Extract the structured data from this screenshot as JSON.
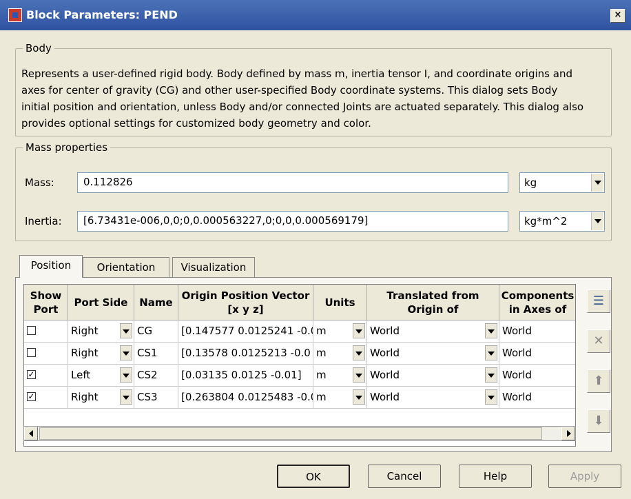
{
  "window": {
    "title": "Block Parameters: PEND",
    "close_label": "×"
  },
  "body_group": {
    "legend": "Body",
    "description": "Represents a user-defined rigid body. Body defined by mass m, inertia tensor I, and coordinate origins and axes for center of gravity (CG) and other user-specified Body coordinate systems. This dialog sets Body initial position and orientation, unless Body and/or connected Joints are actuated separately. This dialog also provides optional settings for customized body geometry and color."
  },
  "mass_properties": {
    "legend": "Mass properties",
    "mass_label": "Mass:",
    "mass_value": "0.112826",
    "mass_unit": "kg",
    "inertia_label": "Inertia:",
    "inertia_value": "[6.73431e-006,0,0;0,0.000563227,0;0,0,0.000569179]",
    "inertia_unit": "kg*m^2"
  },
  "tabs": [
    {
      "label": "Position",
      "active": true
    },
    {
      "label": "Orientation",
      "active": false
    },
    {
      "label": "Visualization",
      "active": false
    }
  ],
  "table": {
    "headers": [
      "Show Port",
      "Port Side",
      "Name",
      "Origin Position Vector [x y z]",
      "Units",
      "Translated from Origin of",
      "Components in Axes of"
    ],
    "rows": [
      {
        "show_port": false,
        "port_side": "Right",
        "name": "CG",
        "origin": "[0.147577 0.0125241 -0.0",
        "units": "m",
        "translated_from": "World",
        "components": "World"
      },
      {
        "show_port": false,
        "port_side": "Right",
        "name": "CS1",
        "origin": "[0.13578 0.0125213 -0.0",
        "units": "m",
        "translated_from": "World",
        "components": "World"
      },
      {
        "show_port": true,
        "port_side": "Left",
        "name": "CS2",
        "origin": "[0.03135 0.0125 -0.01]",
        "units": "m",
        "translated_from": "World",
        "components": "World"
      },
      {
        "show_port": true,
        "port_side": "Right",
        "name": "CS3",
        "origin": "[0.263804 0.0125483 -0.0",
        "units": "m",
        "translated_from": "World",
        "components": "World"
      }
    ]
  },
  "side_buttons": [
    {
      "icon": "add-row-icon",
      "glyph": "☰",
      "enabled": true
    },
    {
      "icon": "delete-icon",
      "glyph": "✕",
      "enabled": false
    },
    {
      "icon": "move-up-icon",
      "glyph": "⬆",
      "enabled": false
    },
    {
      "icon": "move-down-icon",
      "glyph": "⬇",
      "enabled": false
    }
  ],
  "buttons": {
    "ok": "OK",
    "cancel": "Cancel",
    "help": "Help",
    "apply": "Apply"
  },
  "checkbox_checked_glyph": "✓"
}
